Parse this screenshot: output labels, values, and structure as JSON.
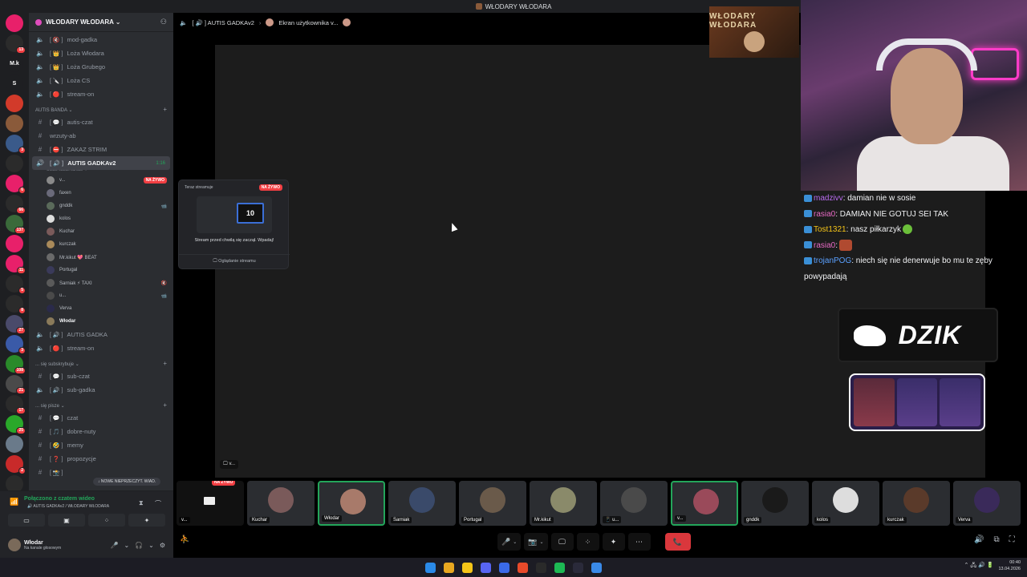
{
  "window": {
    "title": "WŁODARY WŁODARA"
  },
  "guild": {
    "name": "WŁODARY WŁODARA ⌄"
  },
  "servers": [
    {
      "color": "#e8206a",
      "badge": ""
    },
    {
      "color": "#2b2b2b",
      "badge": "13"
    },
    {
      "color": "#1e1f22",
      "badge": "",
      "label": "M.k"
    },
    {
      "color": "#1e1f22",
      "badge": "",
      "label": "S"
    },
    {
      "color": "#d23a2a",
      "badge": ""
    },
    {
      "color": "#8a5a3a",
      "badge": ""
    },
    {
      "color": "#3a5a8a",
      "badge": "3"
    },
    {
      "color": "#2b2b2b",
      "badge": ""
    },
    {
      "color": "#e8206a",
      "badge": "6"
    },
    {
      "color": "#2b2b2b",
      "badge": "66"
    },
    {
      "color": "#3a6a3a",
      "badge": "137"
    },
    {
      "color": "#e8206a",
      "badge": ""
    },
    {
      "color": "#e8206a",
      "badge": "11"
    },
    {
      "color": "#2b2b2b",
      "badge": "5"
    },
    {
      "color": "#2b2b2b",
      "badge": "8"
    },
    {
      "color": "#4a4a6a",
      "badge": "27"
    },
    {
      "color": "#3a5aa8",
      "badge": "3"
    },
    {
      "color": "#2a8a2a",
      "badge": "108"
    },
    {
      "color": "#4a4a4a",
      "badge": "21"
    },
    {
      "color": "#2b2b2b",
      "badge": "17"
    },
    {
      "color": "#2aa82a",
      "badge": "25"
    },
    {
      "color": "#6a7a8a",
      "badge": ""
    },
    {
      "color": "#c82a2a",
      "badge": "2"
    },
    {
      "color": "#2b2b2b",
      "badge": ""
    }
  ],
  "servers_nowe": "NOWE",
  "channels": {
    "top": [
      {
        "icon": "🔈",
        "tag": "[ 🔇 ]",
        "name": "mod-gadka"
      },
      {
        "icon": "🔈",
        "tag": "[ 👑 ]",
        "name": "Loża Włodara"
      },
      {
        "icon": "🔈",
        "tag": "[ 👑 ]",
        "name": "Loża Grubego"
      },
      {
        "icon": "🔈",
        "tag": "[ 🔪 ]",
        "name": "Loża CS"
      },
      {
        "icon": "🔈",
        "tag": "[ 🔴 ]",
        "name": "stream-on"
      }
    ],
    "cat1": "AUTIS BANDA ⌄",
    "cat1_add": "+",
    "group1": [
      {
        "icon": "#",
        "tag": "[ 💬 ]",
        "name": "autis-czat"
      },
      {
        "icon": "#",
        "tag": "",
        "name": "wrzuty-ab"
      },
      {
        "icon": "#",
        "tag": "[ ⛔ ]",
        "name": "ZAKAZ STRIM"
      }
    ],
    "active": {
      "icon": "🔊",
      "tag": "[ 🔊 ]",
      "name": "AUTIS GADKAv2",
      "time": "1:16",
      "status": "Ustaw status kanału ✎"
    },
    "voice_users": [
      {
        "name": "v...",
        "color": "#8a8a8a",
        "extra": "NA ŻYWO",
        "kind": "live"
      },
      {
        "name": "faxen",
        "color": "#6a6a7a",
        "extra": "",
        "kind": ""
      },
      {
        "name": "gnddk",
        "color": "#5a6a5a",
        "extra": "📹",
        "kind": "cam"
      },
      {
        "name": "kolos",
        "color": "#ddd",
        "extra": "",
        "kind": ""
      },
      {
        "name": "Kuchar",
        "color": "#7a5a5a",
        "extra": "",
        "kind": ""
      },
      {
        "name": "kurczak",
        "color": "#aa8a5a",
        "extra": "",
        "kind": ""
      },
      {
        "name": "Mr.kikut  💖 BEAT",
        "color": "#6a6a6a",
        "extra": "",
        "kind": ""
      },
      {
        "name": "Portugal",
        "color": "#3a3a5a",
        "extra": "",
        "kind": ""
      },
      {
        "name": "Sarniak  ⚡ TAXI",
        "color": "#5a5a5a",
        "extra": "🔇",
        "kind": "cam"
      },
      {
        "name": "u...",
        "color": "#4a4a4a",
        "extra": "📹",
        "kind": "cam"
      },
      {
        "name": "Verva",
        "color": "#2a2a4a",
        "extra": "",
        "kind": ""
      },
      {
        "name": "Włodar",
        "color": "#8a7a5a",
        "extra": "",
        "kind": "bold"
      }
    ],
    "group2": [
      {
        "icon": "🔈",
        "tag": "[ 🔊 ]",
        "name": "AUTIS GADKA"
      },
      {
        "icon": "🔈",
        "tag": "[ 🔴 ]",
        "name": "stream-on"
      }
    ],
    "cat2": "... się subskrybuje ⌄",
    "cat2_add": "+",
    "group3": [
      {
        "icon": "#",
        "tag": "[ 💬 ]",
        "name": "sub-czat"
      },
      {
        "icon": "🔈",
        "tag": "[ 🔊 ]",
        "name": "sub-gadka"
      }
    ],
    "cat3": "... się pisze ⌄",
    "cat3_add": "+",
    "group4": [
      {
        "icon": "#",
        "tag": "[ 💬 ]",
        "name": "czat"
      },
      {
        "icon": "#",
        "tag": "[ 🎵 ]",
        "name": "dobre-nuty"
      },
      {
        "icon": "#",
        "tag": "[ 🤣 ]",
        "name": "memy"
      },
      {
        "icon": "#",
        "tag": "[ ❓ ]",
        "name": "propozycje"
      },
      {
        "icon": "#",
        "tag": "[ 📸 ]",
        "name": ""
      }
    ],
    "unread_pill": "↓ NOWE NIEPRZECZYT. WIAD."
  },
  "voice_panel": {
    "connected": "Połączono z czatem wideo",
    "location": "🔊 AUTIS GADKAv2 / WŁODARY WŁODARA",
    "buttons": [
      "▭",
      "▣",
      "⁘",
      "✦"
    ]
  },
  "user": {
    "name": "Włodar",
    "status": "Na kanale głosowym",
    "controls": [
      "🎤",
      "⌄",
      "🎧",
      "⌄",
      "⚙"
    ]
  },
  "stage_header": {
    "channel": "[ 🔊 ] AUTIS GADKAv2",
    "sep": "›",
    "screen": "Ekran użytkownika v..."
  },
  "popup": {
    "title": "Teraz streamuje",
    "live": "NA ŻYWO",
    "monitor": "10",
    "subtitle": "Stream przed chwilą się zaczął. Wpadaj!",
    "button": "🖵 Oglądanie streamu"
  },
  "screen_tag": "🖵 v...",
  "overlay": {
    "logo_text": "WŁODARY WŁODARA"
  },
  "chat": [
    {
      "user": "madzivv",
      "text": ": damian nie w sosie",
      "cls": "u1",
      "badge": true
    },
    {
      "user": "rasia0",
      "text": ": DAMIAN NIE GOTUJ SEI TAK",
      "cls": "u2",
      "badge": true
    },
    {
      "user": "Tost1321",
      "text": ": nasz piłkarzyk",
      "cls": "u3",
      "badge": true,
      "emo": "emo"
    },
    {
      "user": "rasia0",
      "text": ":",
      "cls": "u2",
      "badge": true,
      "emo": "emo2"
    },
    {
      "user": "trojanPOG",
      "text": ": niech się nie denerwuje bo mu te zęby powypadają",
      "cls": "u5",
      "badge": true
    }
  ],
  "dzik": "DZIK",
  "tiles": [
    {
      "label": "v...",
      "kind": "first",
      "live": "NA ŻYWO",
      "color": "#111"
    },
    {
      "label": "Kuchar",
      "kind": "",
      "color": "#7a5a5a"
    },
    {
      "label": "Włodar",
      "kind": "spk",
      "color": "#a87a6a"
    },
    {
      "label": "Sarniak",
      "kind": "",
      "color": "#3a4a6a"
    },
    {
      "label": "Portugal",
      "kind": "",
      "color": "#6a5a4a"
    },
    {
      "label": "Mr.kikut",
      "kind": "",
      "color": "#8a8a6a"
    },
    {
      "label": "📱 u...",
      "kind": "",
      "color": "#4a4a4a"
    },
    {
      "label": "v...",
      "kind": "spk",
      "color": "#9a4a5a"
    },
    {
      "label": "gnddk",
      "kind": "",
      "color": "#1a1a1a"
    },
    {
      "label": "kolos",
      "kind": "",
      "color": "#ddd"
    },
    {
      "label": "kurczak",
      "kind": "",
      "color": "#5a3a2a"
    },
    {
      "label": "Verva",
      "kind": "",
      "color": "#3a2a5a"
    }
  ],
  "controls": {
    "mic": "🎤",
    "cam": "📷",
    "share": "🖵",
    "activity": "⁘",
    "soundboard": "✦",
    "more": "⋯",
    "leave": "📞",
    "chev": "⌄"
  },
  "right_controls": [
    "🔊",
    "⧉",
    "⛶"
  ],
  "left_control": "⛹",
  "taskbar": {
    "apps": [
      "#2a8ae8",
      "#e8a820",
      "#f5c518",
      "#5865f2",
      "#3a6ae8",
      "#e84a2a",
      "#2a2a2a",
      "#1db954",
      "#2a2a3a",
      "#3a8ae8"
    ],
    "time": "00:40",
    "date": "13.04.2026",
    "tray": "⌃  🖧  🔊  🔋"
  }
}
